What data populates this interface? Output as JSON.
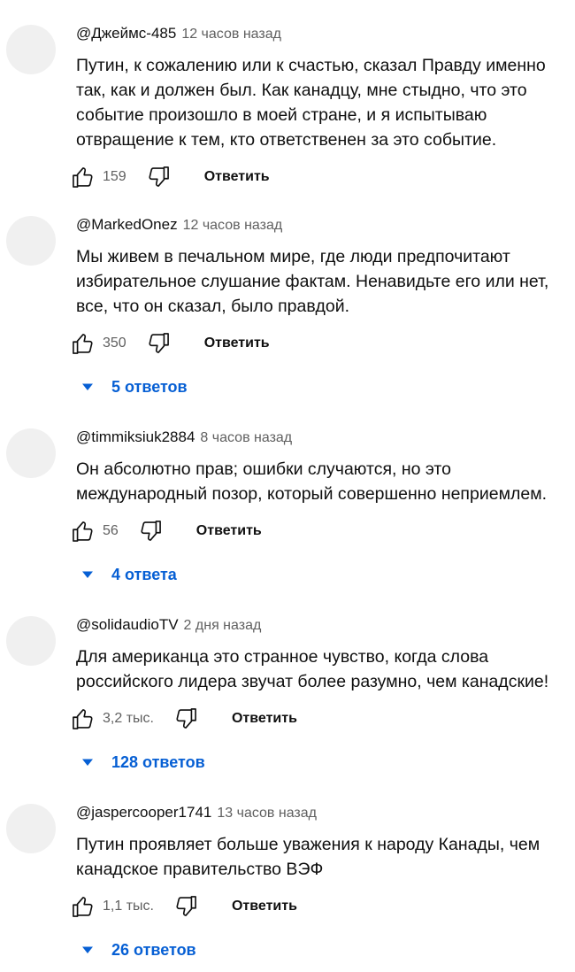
{
  "reply_label": "Ответить",
  "colors": {
    "link": "#065fd4",
    "secondary": "#606060",
    "avatar": "#f0f0f0"
  },
  "comments": [
    {
      "author": "@Джеймс-485",
      "time": "12 часов назад",
      "text": "Путин, к сожалению или к счастью, сказал Правду именно так, как и должен был. Как канадцу, мне стыдно, что это событие произошло в моей стране, и я испытываю отвращение к тем, кто ответственен за это событие.",
      "likes": "159"
    },
    {
      "author": "@MarkedOnez",
      "time": "12 часов назад",
      "text": "Мы живем в печальном мире, где люди предпочитают избирательное слушание фактам. Ненавидьте его или нет, все, что он сказал, было правдой.",
      "likes": "350",
      "replies": "5 ответов"
    },
    {
      "author": "@timmiksiuk2884",
      "time": "8 часов назад",
      "text": "Он абсолютно прав; ошибки случаются, но это международный позор, который совершенно неприемлем.",
      "likes": "56",
      "replies": "4 ответа"
    },
    {
      "author": "@solidaudioTV",
      "time": "2 дня назад",
      "text": "Для американца это странное чувство, когда слова российского лидера звучат более разумно, чем канадские!",
      "likes": "3,2 тыс.",
      "replies": "128 ответов"
    },
    {
      "author": "@jaspercooper1741",
      "time": "13 часов назад",
      "text": "Путин проявляет больше уважения к народу Канады, чем канадское правительство ВЭФ",
      "likes": "1,1 тыс.",
      "replies": "26 ответов"
    }
  ]
}
